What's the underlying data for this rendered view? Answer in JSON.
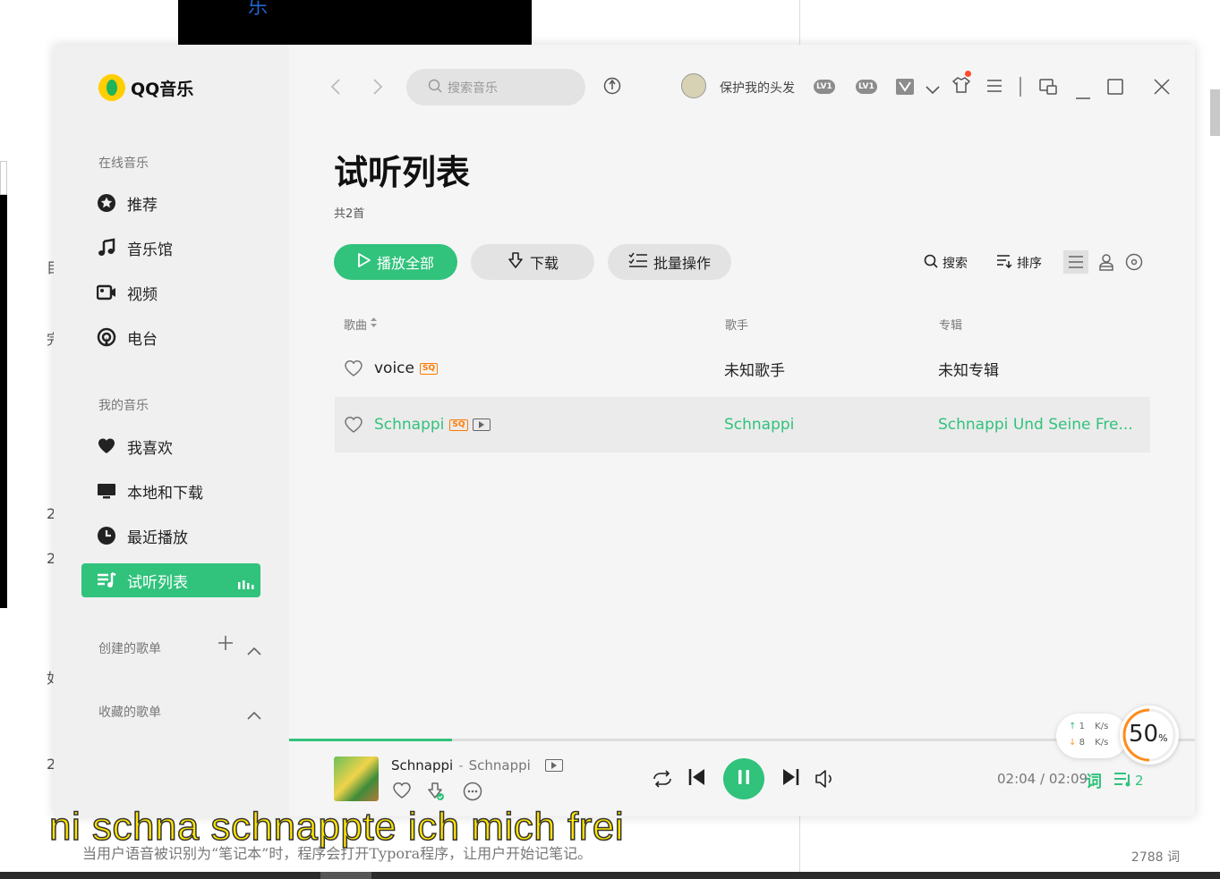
{
  "background": {
    "top_glyph": "乐",
    "doc_text": "当用户语音被识别为“笔记本”时，程序会打开Typora程序，让用户开始记笔记。",
    "word_count": "2788 词",
    "left_chars": [
      "目",
      "完",
      "2",
      "2",
      "如",
      "2"
    ]
  },
  "subtitle": "ni schna schnappte ich mich frei",
  "app": {
    "logo": "QQ音乐",
    "sidebar": {
      "online_title": "在线音乐",
      "online_items": [
        {
          "label": "推荐",
          "icon": "star-icon"
        },
        {
          "label": "音乐馆",
          "icon": "music-note-icon"
        },
        {
          "label": "视频",
          "icon": "video-icon"
        },
        {
          "label": "电台",
          "icon": "radio-icon"
        }
      ],
      "mine_title": "我的音乐",
      "mine_items": [
        {
          "label": "我喜欢",
          "icon": "heart-icon"
        },
        {
          "label": "本地和下载",
          "icon": "monitor-icon"
        },
        {
          "label": "最近播放",
          "icon": "clock-icon"
        },
        {
          "label": "试听列表",
          "icon": "playlist-icon",
          "active": true
        }
      ],
      "created_title": "创建的歌单",
      "collected_title": "收藏的歌单"
    },
    "topbar": {
      "search_placeholder": "搜索音乐",
      "username": "保护我的头发",
      "badges": [
        "LV1",
        "LV1"
      ]
    },
    "page": {
      "title": "试听列表",
      "count": "共2首",
      "buttons": {
        "play_all": "播放全部",
        "download": "下载",
        "batch": "批量操作"
      },
      "tools": {
        "search": "搜索",
        "sort": "排序"
      },
      "columns": {
        "song": "歌曲",
        "artist": "歌手",
        "album": "专辑"
      },
      "songs": [
        {
          "title": "voice",
          "quality": "SQ",
          "has_mv": false,
          "artist": "未知歌手",
          "album": "未知专辑",
          "playing": false
        },
        {
          "title": "Schnappi",
          "quality": "SQ",
          "has_mv": true,
          "artist": "Schnappi",
          "album": "Schnappi Und Seine Fre...",
          "playing": true
        }
      ]
    },
    "player": {
      "title": "Schnappi",
      "separator": "-",
      "artist": "Schnappi",
      "time": "02:04 / 02:09",
      "lyric_label": "词",
      "queue_count": "2",
      "progress": 0.18
    },
    "speed_widget": {
      "up_value": "1",
      "up_unit": "K/s",
      "down_value": "8",
      "down_unit": "K/s",
      "percent": "50",
      "percent_sign": "%"
    },
    "colors": {
      "accent": "#31c27c",
      "quality": "#ff7a00"
    }
  }
}
